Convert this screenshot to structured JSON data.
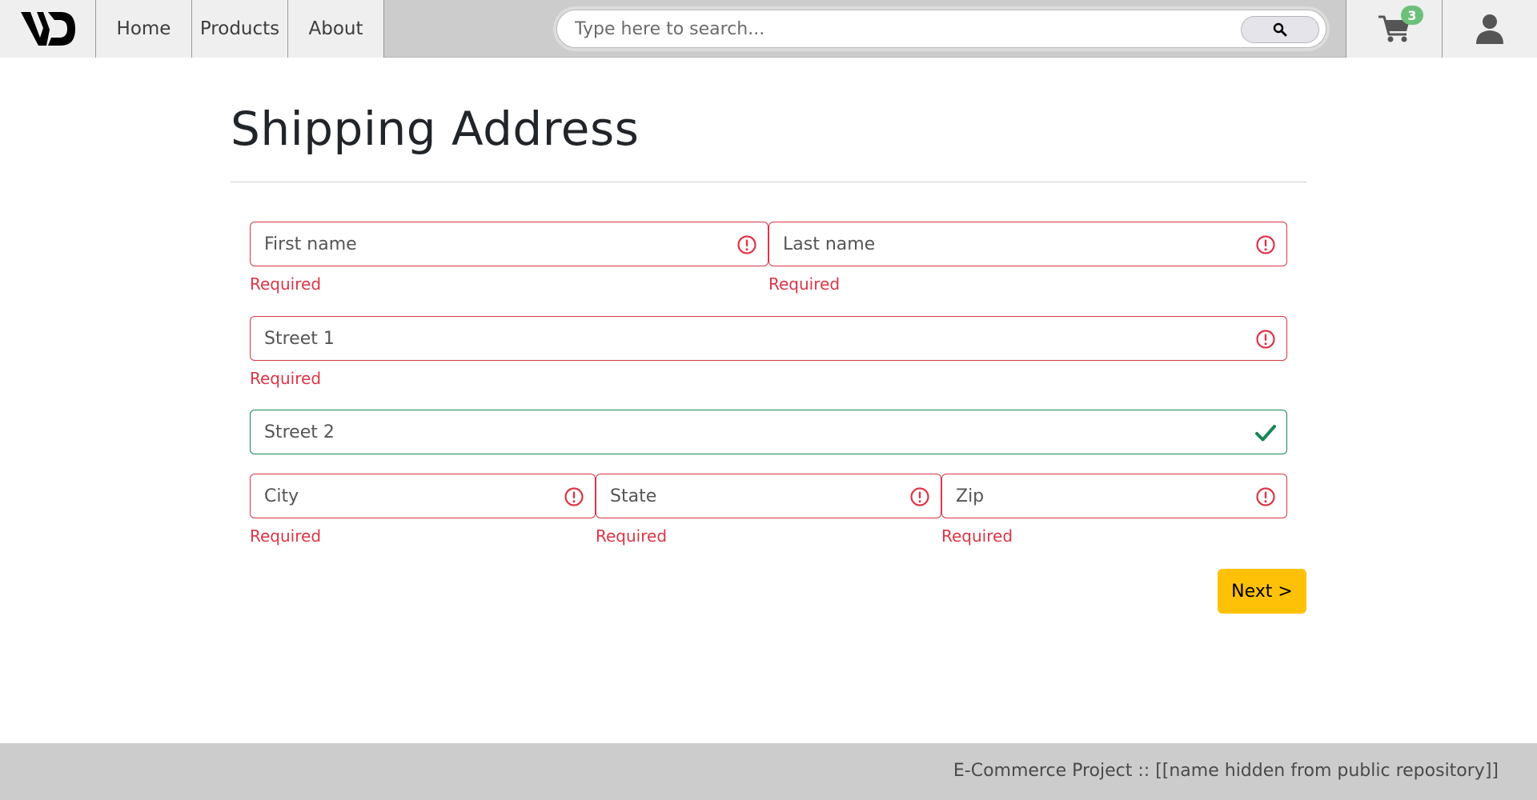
{
  "navbar": {
    "logo_text": "VD",
    "links": [
      {
        "label": "Home"
      },
      {
        "label": "Products"
      },
      {
        "label": "About"
      }
    ],
    "search": {
      "placeholder": "Type here to search...",
      "button_icon": "search-icon"
    },
    "cart": {
      "icon": "cart-icon",
      "count": "3"
    },
    "user": {
      "icon": "user-icon"
    }
  },
  "form": {
    "title": "Shipping Address",
    "fields": {
      "first_name": {
        "placeholder": "First name",
        "value": "",
        "status": "invalid",
        "feedback": "Required"
      },
      "last_name": {
        "placeholder": "Last name",
        "value": "",
        "status": "invalid",
        "feedback": "Required"
      },
      "street1": {
        "placeholder": "Street 1",
        "value": "",
        "status": "invalid",
        "feedback": "Required"
      },
      "street2": {
        "placeholder": "Street 2",
        "value": "",
        "status": "valid"
      },
      "city": {
        "placeholder": "City",
        "value": "",
        "status": "invalid",
        "feedback": "Required"
      },
      "state": {
        "placeholder": "State",
        "value": "",
        "status": "invalid",
        "feedback": "Required"
      },
      "zip": {
        "placeholder": "Zip",
        "value": "",
        "status": "invalid",
        "feedback": "Required"
      }
    },
    "next_label": "Next >"
  },
  "footer": {
    "text": "E-Commerce Project :: [[name hidden from public repository]]"
  },
  "colors": {
    "invalid": "#dc3545",
    "valid": "#198754",
    "accent_button": "#ffc107",
    "navbar_bg": "#cccccc",
    "badge": "#6dc07a"
  }
}
